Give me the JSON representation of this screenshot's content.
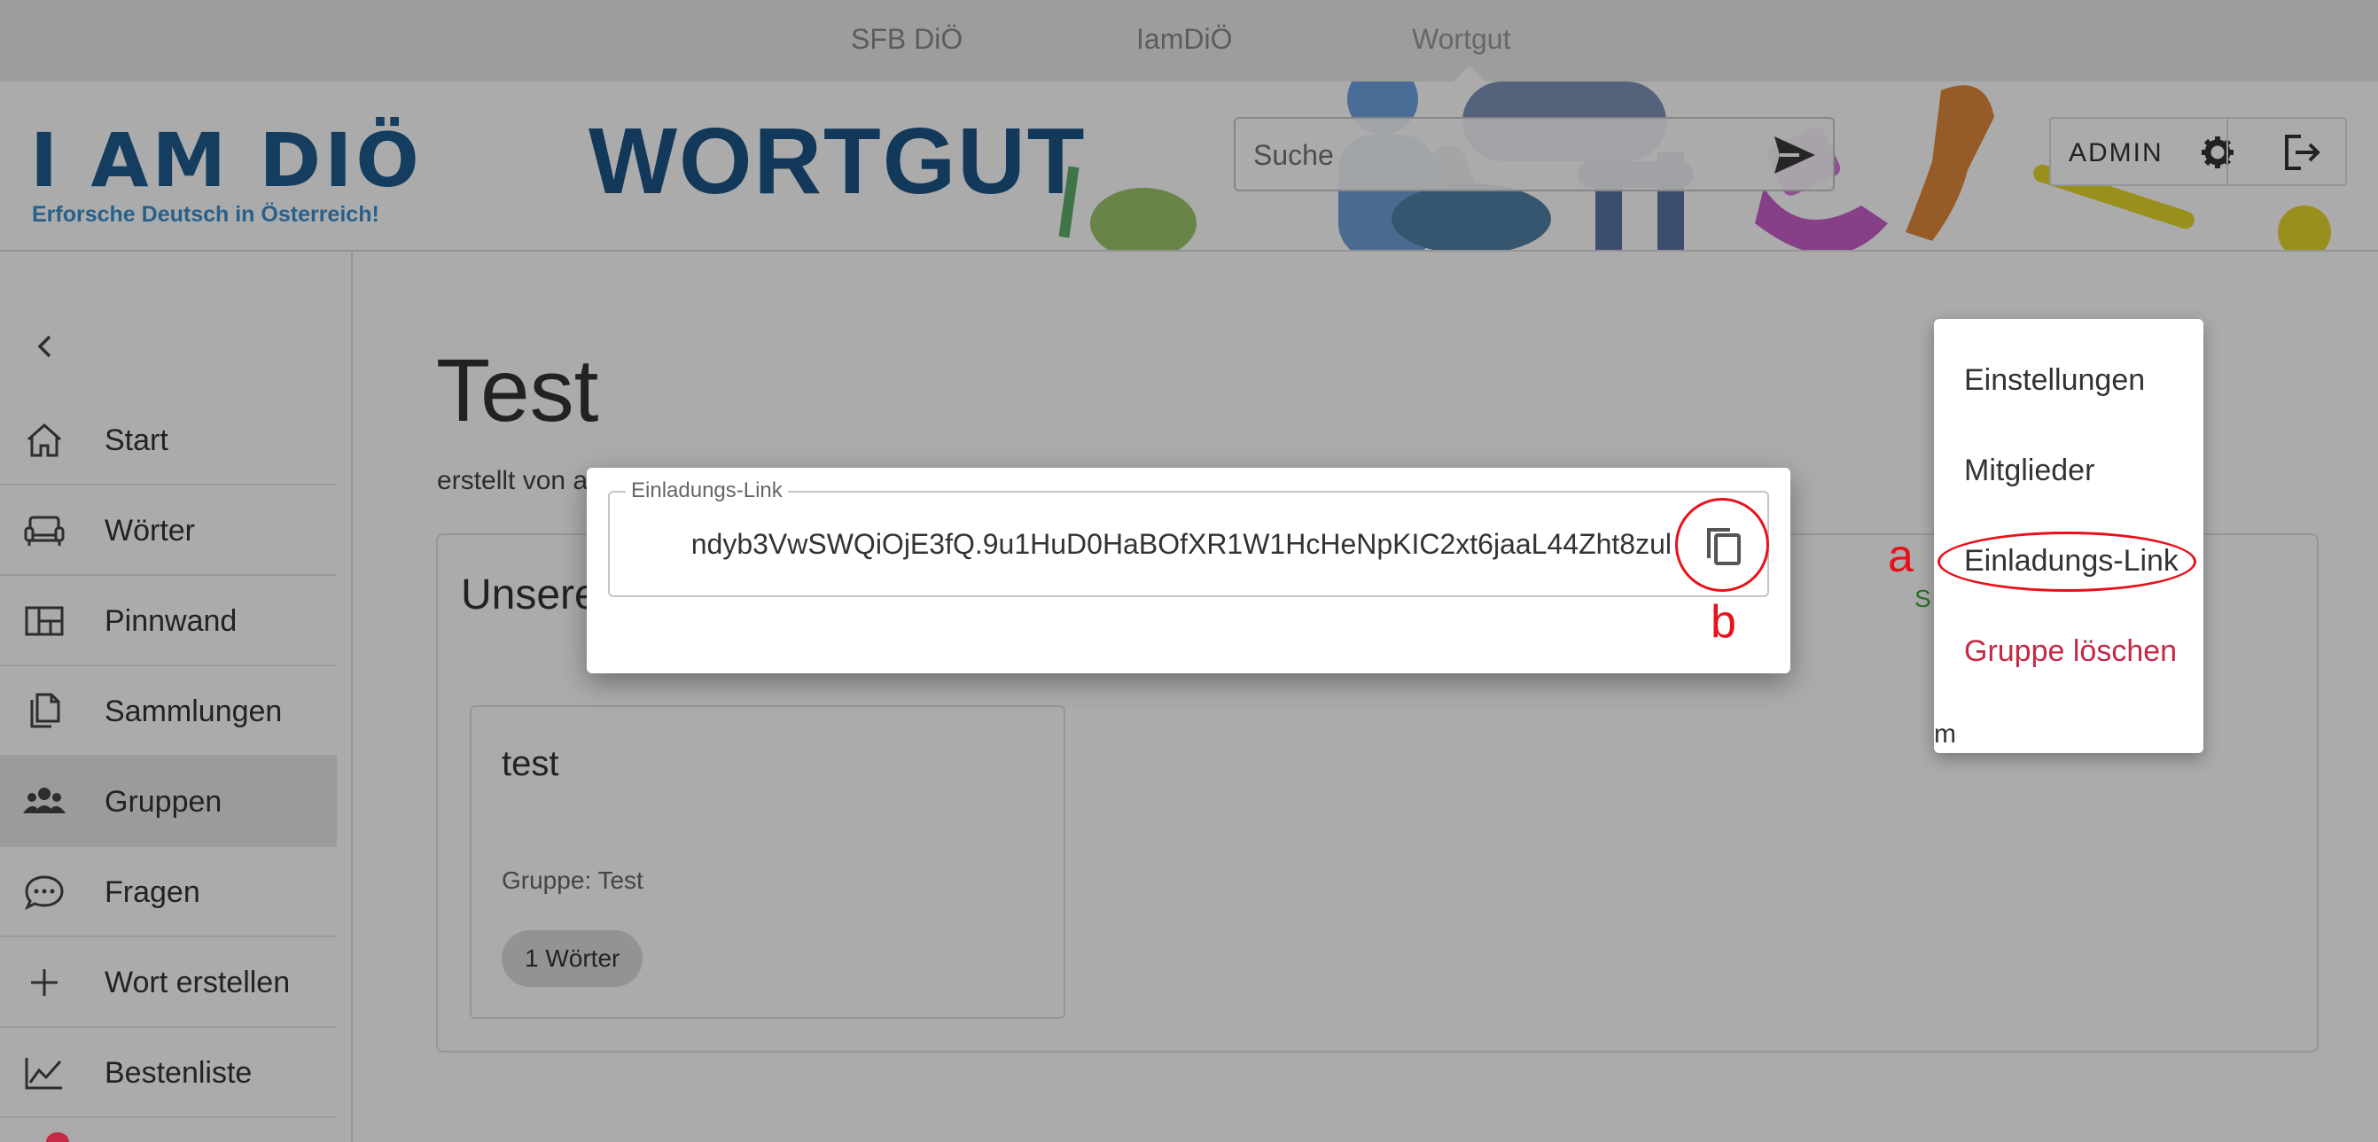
{
  "topnav": {
    "tabs": [
      "SFB DiÖ",
      "IamDiÖ",
      "Wortgut"
    ],
    "active_index": 2
  },
  "header": {
    "logo_text": "I AM DIÖ",
    "logo_tagline": "Erforsche Deutsch in Österreich!",
    "app_title": "WORTGUT",
    "search_placeholder": "Suche",
    "user_label": "ADMIN",
    "send_icon": "send-icon",
    "settings_icon": "gear-icon",
    "logout_icon": "logout-icon"
  },
  "sidebar": {
    "collapse_icon": "chevron-left-icon",
    "items": [
      {
        "label": "Start",
        "icon": "home-icon"
      },
      {
        "label": "Wörter",
        "icon": "sofa-icon"
      },
      {
        "label": "Pinnwand",
        "icon": "dashboard-icon"
      },
      {
        "label": "Sammlungen",
        "icon": "documents-icon"
      },
      {
        "label": "Gruppen",
        "icon": "people-icon",
        "active": true
      },
      {
        "label": "Fragen",
        "icon": "chat-icon"
      },
      {
        "label": "Wort erstellen",
        "icon": "plus-icon"
      },
      {
        "label": "Bestenliste",
        "icon": "chart-icon"
      }
    ]
  },
  "main": {
    "title": "Test",
    "byline": "erstellt von a",
    "panel_title": "Unsere",
    "panel_action": "S                    LEN",
    "card": {
      "title": "test",
      "group": "Gruppe: Test",
      "chip": "1 Wörter"
    }
  },
  "menu": {
    "items": [
      {
        "label": "Einstellungen"
      },
      {
        "label": "Mitglieder"
      },
      {
        "label": "Einladungs-Link"
      },
      {
        "label": "Gruppe löschen",
        "danger": true
      }
    ],
    "fragment": "m"
  },
  "modal": {
    "field_label": "Einladungs-Link",
    "field_value": "ndyb3VwSWQiOjE3fQ.9u1HuD0HaBOfXR1W1HcHeNpKIC2xt6jaaL44Zht8zul",
    "copy_icon": "copy-icon"
  },
  "annotations": {
    "a": "a",
    "b": "b"
  },
  "colors": {
    "brand_blue": "#1c5486",
    "danger": "#c62846",
    "annotation_red": "#e8111a",
    "success_green": "#3caa3c"
  }
}
